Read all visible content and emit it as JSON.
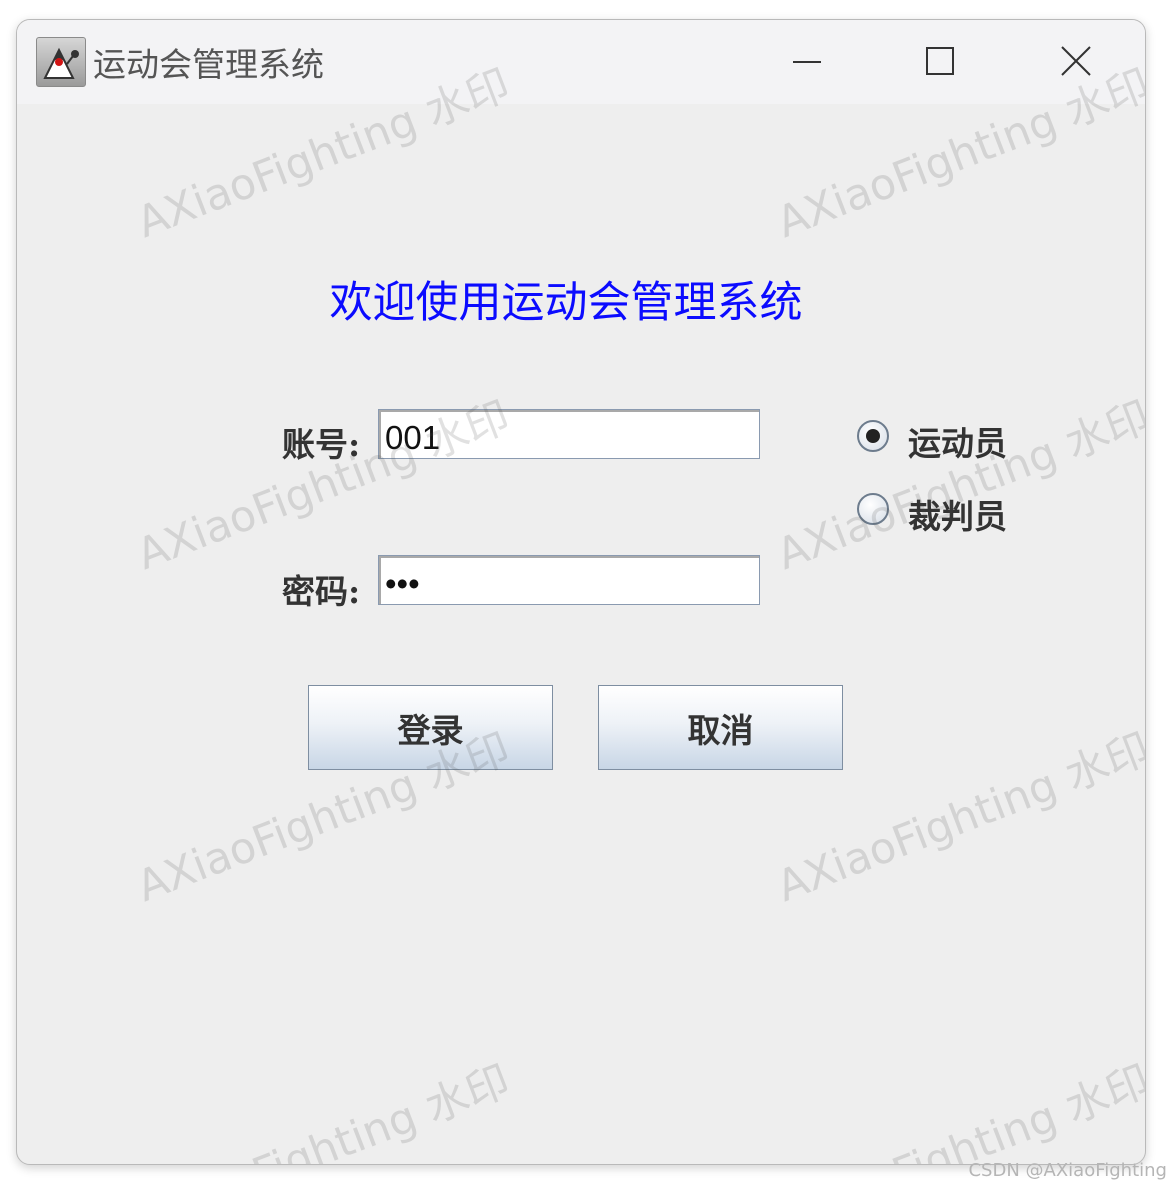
{
  "window": {
    "title": "运动会管理系统",
    "controls": {
      "minimize_icon": "minimize-icon",
      "maximize_icon": "maximize-icon",
      "close_icon": "close-icon"
    }
  },
  "main": {
    "heading": "欢迎使用运动会管理系统",
    "heading_color": "#0b0bff",
    "account": {
      "label": "账号:",
      "value": "001"
    },
    "password": {
      "label": "密码:",
      "masked_value": "•••"
    },
    "role_options": [
      {
        "label": "运动员",
        "selected": true
      },
      {
        "label": "裁判员",
        "selected": false
      }
    ],
    "buttons": {
      "login": "登录",
      "cancel": "取消"
    }
  },
  "watermark": {
    "text": "AXiaoFighting 水印"
  },
  "credit": "CSDN @AXiaoFighting"
}
